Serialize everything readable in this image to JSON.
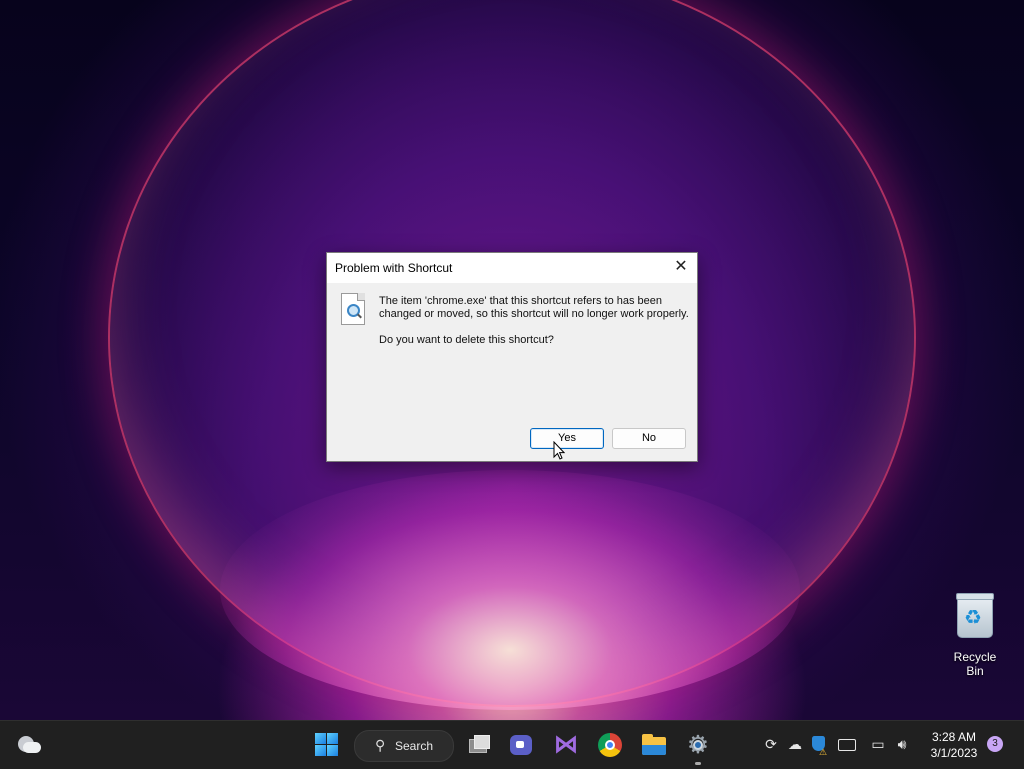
{
  "desktop": {
    "icons": [
      {
        "label": "Recycle Bin",
        "icon": "recycle-bin-icon"
      }
    ]
  },
  "dialog": {
    "title": "Problem with Shortcut",
    "close_glyph": "✕",
    "icon": "file-search-icon",
    "message": "The item 'chrome.exe' that this shortcut refers to has been changed or moved, so this shortcut will no longer work properly.",
    "question": "Do you want to delete this shortcut?",
    "buttons": {
      "yes": "Yes",
      "no": "No"
    }
  },
  "taskbar": {
    "search_label": "Search",
    "apps": [
      {
        "name": "start",
        "icon": "windows-start-icon"
      },
      {
        "name": "search",
        "icon": "search-icon"
      },
      {
        "name": "task-view",
        "icon": "task-view-icon"
      },
      {
        "name": "chat",
        "icon": "teams-chat-icon"
      },
      {
        "name": "visual-studio",
        "icon": "visual-studio-icon"
      },
      {
        "name": "chrome",
        "icon": "chrome-icon"
      },
      {
        "name": "file-explorer",
        "icon": "folder-icon"
      },
      {
        "name": "settings",
        "icon": "gear-icon"
      }
    ],
    "tray_icons": [
      "sync-icon",
      "cloud-off-icon",
      "defender-warning-icon",
      "keyboard-icon",
      "network-icon",
      "volume-icon"
    ],
    "clock": {
      "time": "3:28 AM",
      "date": "3/1/2023"
    },
    "notification_count": "3",
    "weather_icon": "partly-cloudy-icon"
  },
  "colors": {
    "taskbar_bg": "#202020",
    "dialog_bg": "#f0f0f0",
    "accent": "#0067c0"
  }
}
